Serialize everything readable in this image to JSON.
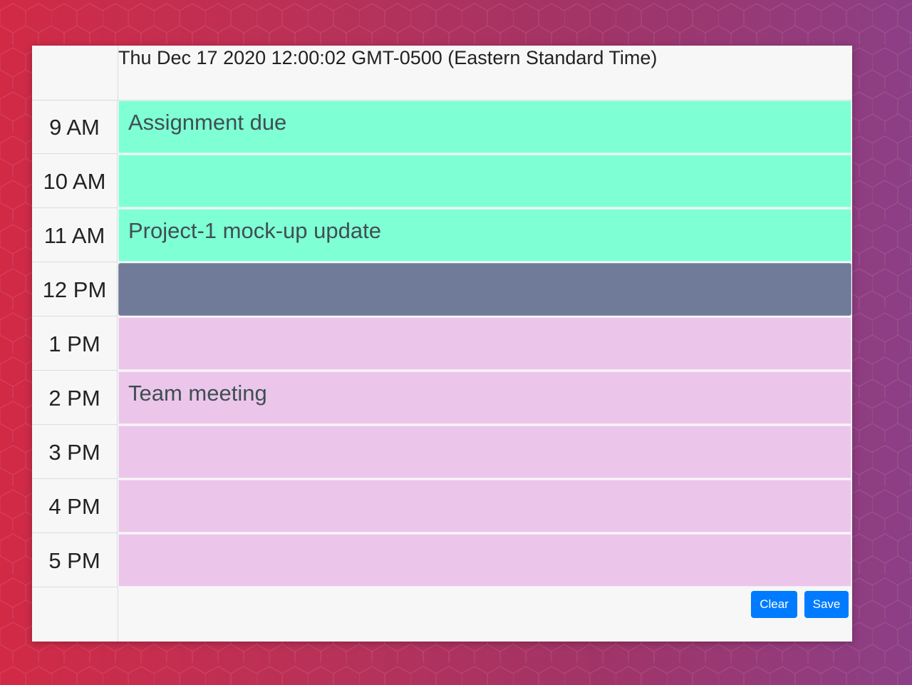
{
  "header": {
    "current_date": "Thu Dec 17 2020 12:00:02 GMT-0500 (Eastern Standard Time)"
  },
  "hours": [
    {
      "label": "9 AM",
      "text": "Assignment due",
      "state": "past"
    },
    {
      "label": "10 AM",
      "text": "",
      "state": "past"
    },
    {
      "label": "11 AM",
      "text": "Project-1 mock-up update",
      "state": "past"
    },
    {
      "label": "12 PM",
      "text": "",
      "state": "present"
    },
    {
      "label": "1 PM",
      "text": "",
      "state": "future"
    },
    {
      "label": "2 PM",
      "text": "Team meeting",
      "state": "future"
    },
    {
      "label": "3 PM",
      "text": "",
      "state": "future"
    },
    {
      "label": "4 PM",
      "text": "",
      "state": "future"
    },
    {
      "label": "5 PM",
      "text": "",
      "state": "future"
    }
  ],
  "buttons": {
    "clear_label": "Clear",
    "save_label": "Save"
  },
  "colors": {
    "past": "#7fffd4",
    "present": "#6f7b98",
    "future": "#ecc6ea",
    "button": "#007bff"
  }
}
